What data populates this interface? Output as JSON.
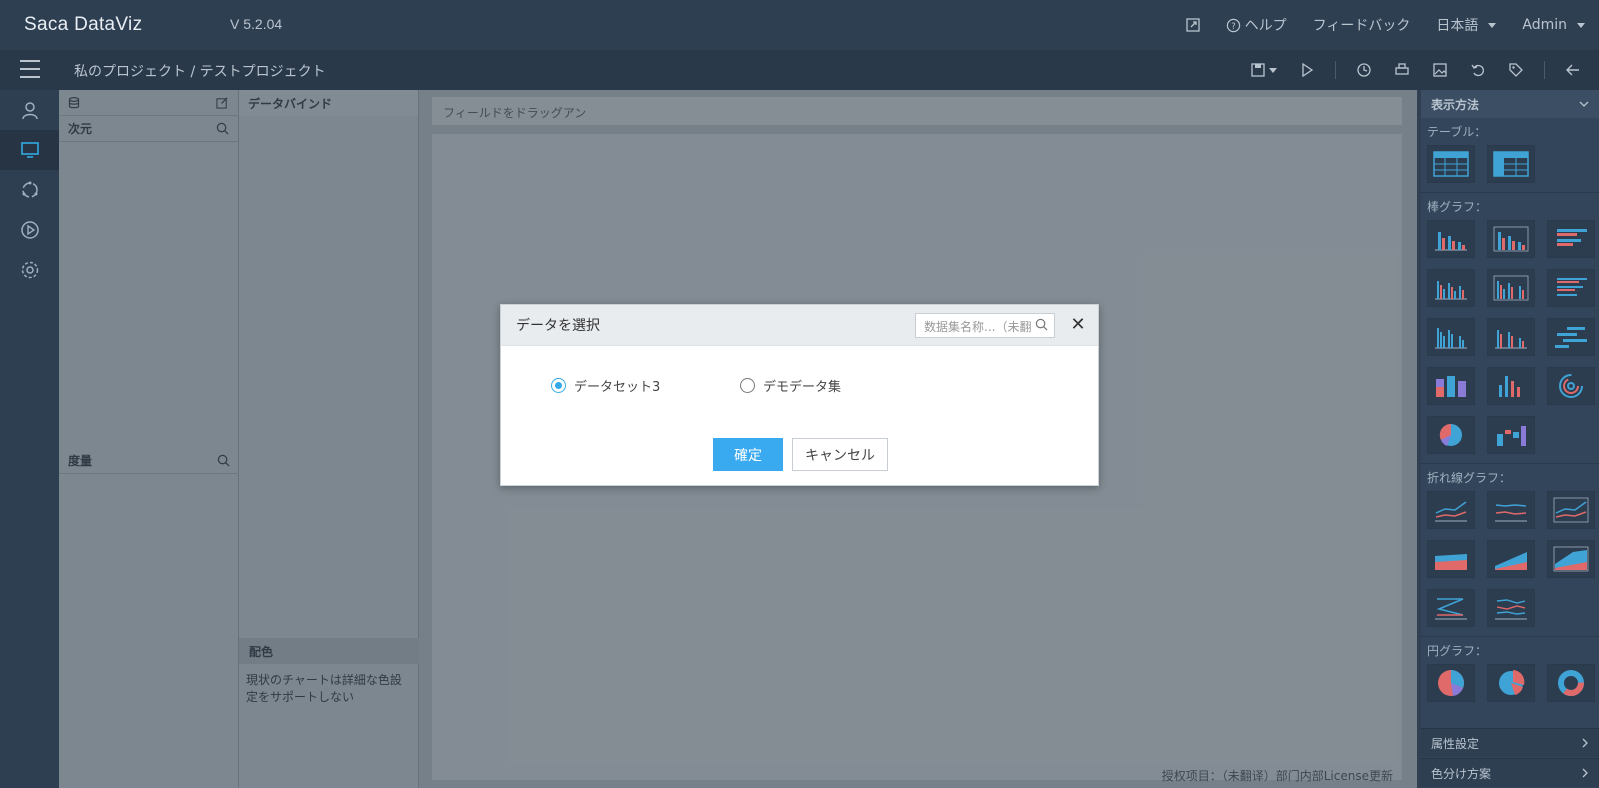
{
  "app": {
    "logo": "Saca DataViz",
    "version": "V 5.2.04"
  },
  "topnav": {
    "help": "ヘルプ",
    "feedback": "フィードバック",
    "language": "日本語",
    "user": "Admin"
  },
  "breadcrumb": "私のプロジェクト  /  テストプロジェクト",
  "panels": {
    "dimension_label": "次元",
    "measure_label": "度量",
    "data_bind_label": "データバインド",
    "color_label": "配色",
    "color_note": "現状のチャートは詳細な色設定をサポートしない"
  },
  "workspace": {
    "drop_hint": "フィールドをドラッグアン",
    "license": "授权项目：（未翻译）部门内部License更新"
  },
  "sidebar": {
    "title": "表示方法",
    "sections": {
      "table": "テーブル：",
      "bar": "棒グラフ：",
      "line": "折れ線グラフ：",
      "pie": "円グラフ："
    },
    "attr_settings": "属性設定",
    "color_scheme": "色分け方案"
  },
  "dialog": {
    "title": "データを選択",
    "search_placeholder": "数据集名称...（未翻",
    "options": [
      "データセット3",
      "デモデータ集"
    ],
    "selected_index": 0,
    "ok": "確定",
    "cancel": "キャンセル"
  },
  "colors": {
    "accent": "#33a9e5",
    "button": "#3aaaf0",
    "bar_blue": "#3fa3d6",
    "bar_red": "#e06a6a"
  }
}
